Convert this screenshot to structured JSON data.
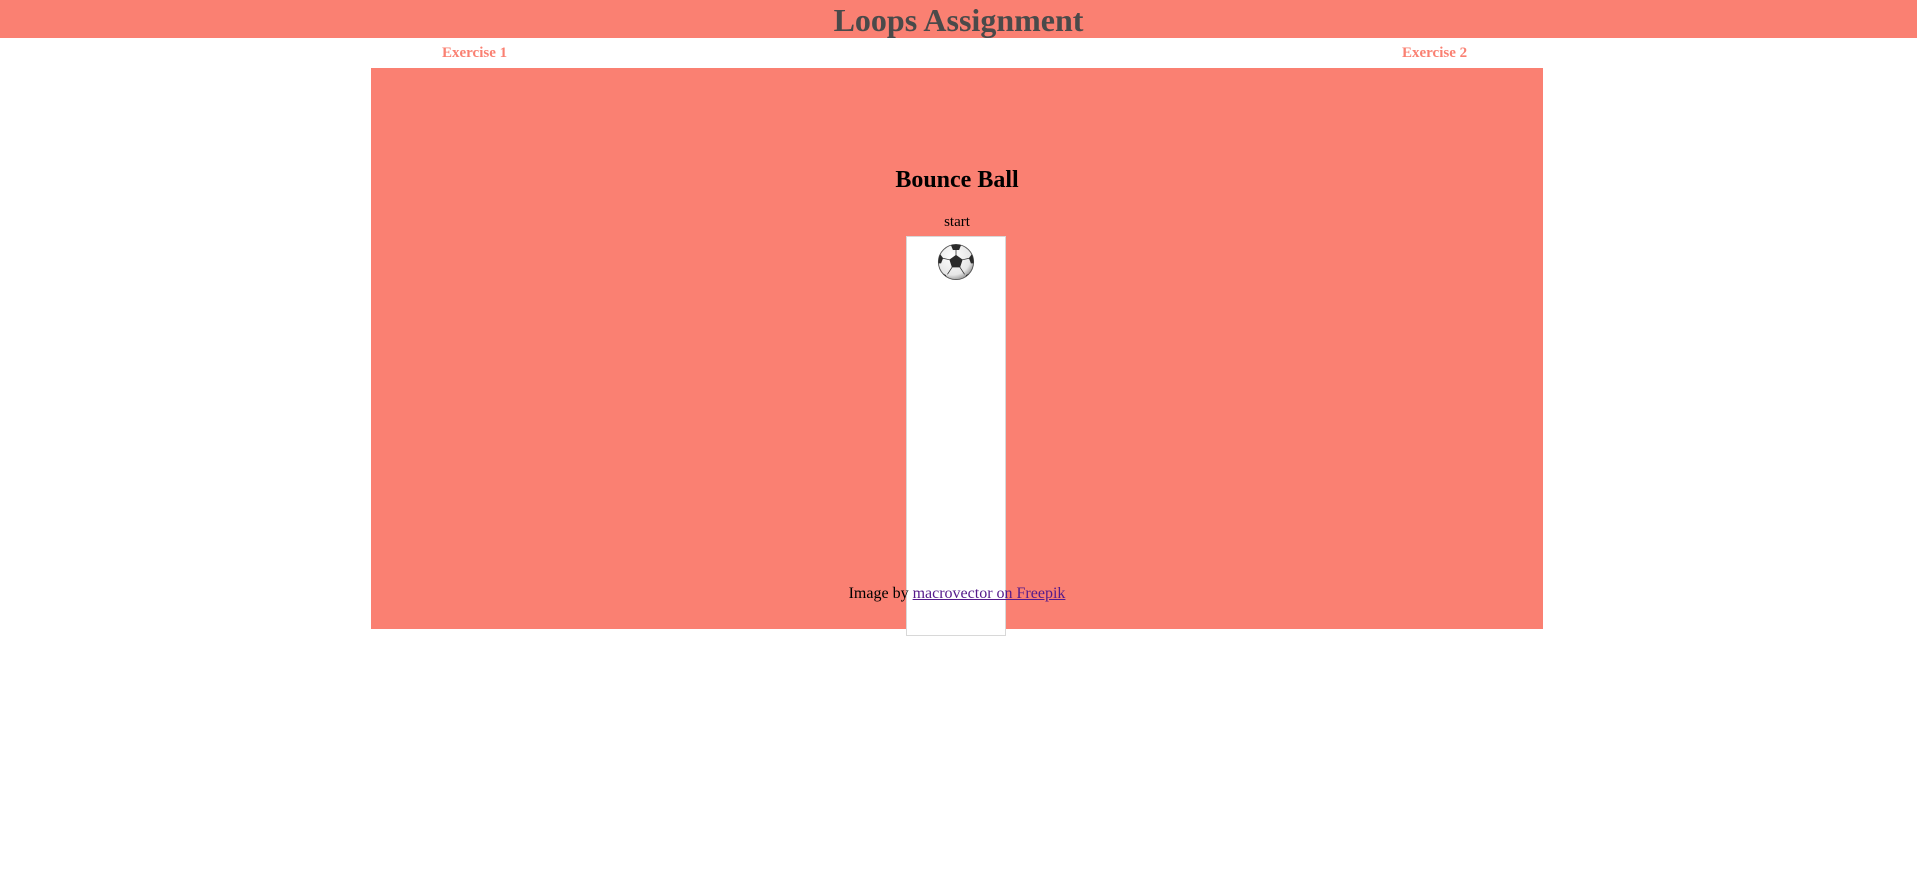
{
  "header": {
    "title": "Loops Assignment"
  },
  "nav": {
    "exercise1": "Exercise 1",
    "exercise2": "Exercise 2"
  },
  "main": {
    "heading": "Bounce Ball",
    "start_label": "start",
    "ball_icon": "soccer-ball-icon",
    "credit": {
      "prefix": "Image by ",
      "link_text": "macrovector on Freepik"
    }
  },
  "colors": {
    "accent": "#fa8072",
    "title_text": "#4a4a4a",
    "visited_link": "#551a8b"
  }
}
